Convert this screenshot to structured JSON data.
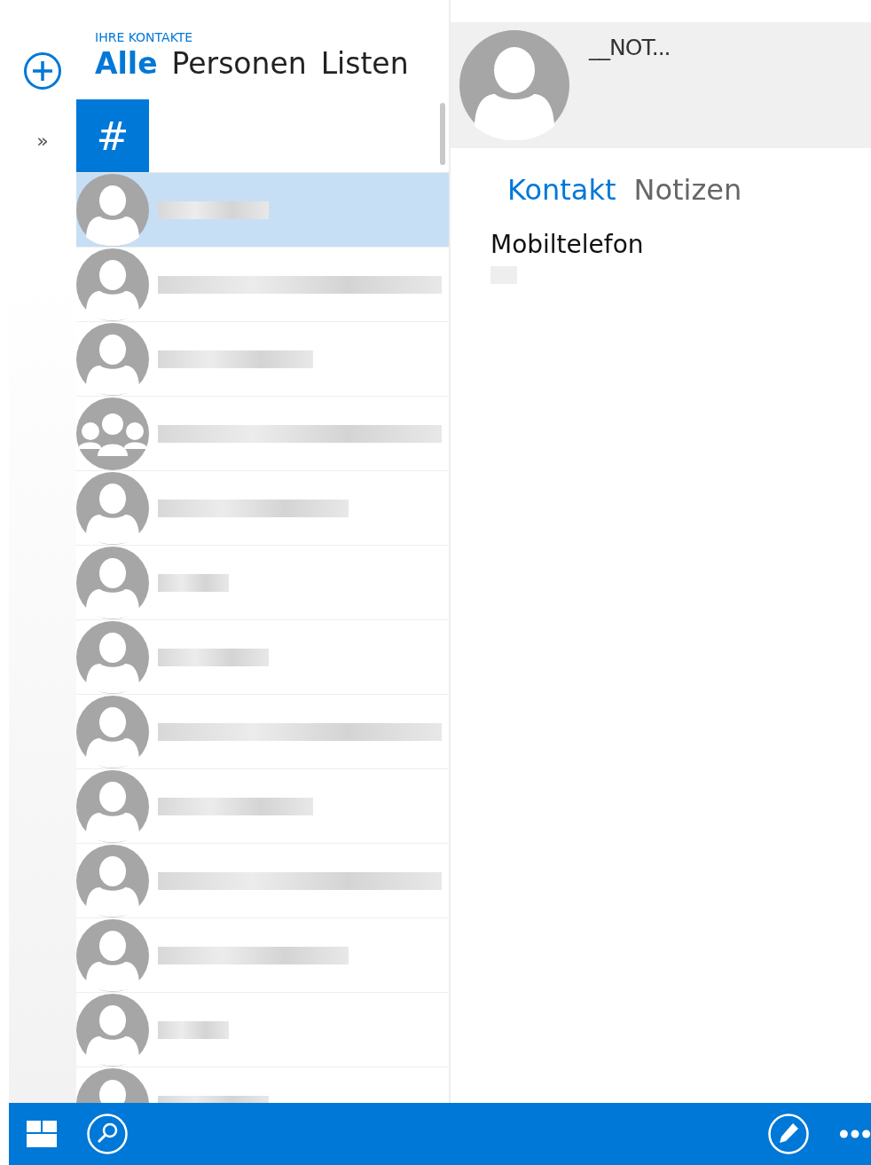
{
  "header": {
    "caption": "IHRE KONTAKTE",
    "tabs": [
      {
        "label": "Alle",
        "selected": true
      },
      {
        "label": "Personen",
        "selected": false
      },
      {
        "label": "Listen",
        "selected": false
      }
    ]
  },
  "expand_glyph": "»",
  "index_letter": {
    "label": "#",
    "selected": true
  },
  "contacts": [
    {
      "kind": "person",
      "selected": true
    },
    {
      "kind": "person",
      "selected": false
    },
    {
      "kind": "person",
      "selected": false
    },
    {
      "kind": "group",
      "selected": false
    },
    {
      "kind": "person",
      "selected": false
    },
    {
      "kind": "person",
      "selected": false
    },
    {
      "kind": "person",
      "selected": false
    },
    {
      "kind": "person",
      "selected": false
    },
    {
      "kind": "person",
      "selected": false
    },
    {
      "kind": "person",
      "selected": false
    },
    {
      "kind": "person",
      "selected": false
    },
    {
      "kind": "person",
      "selected": false
    },
    {
      "kind": "person",
      "selected": false
    }
  ],
  "detail": {
    "name": "__NOT...",
    "tabs": [
      {
        "label": "Kontakt",
        "selected": true
      },
      {
        "label": "Notizen",
        "selected": false
      }
    ],
    "field_label": "Mobiltelefon"
  }
}
